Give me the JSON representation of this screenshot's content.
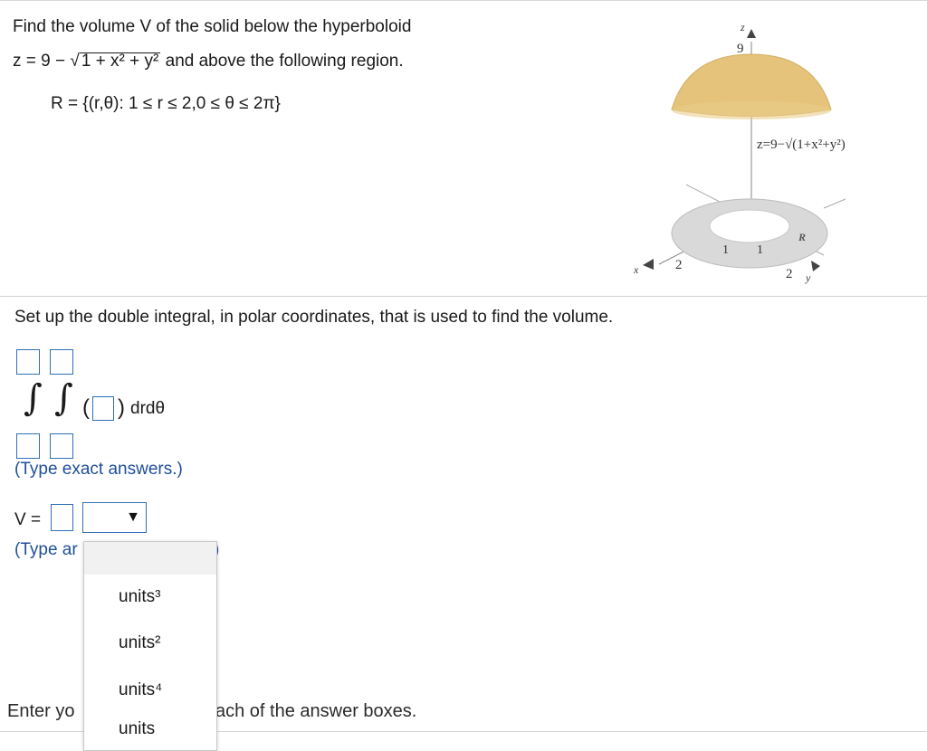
{
  "problem": {
    "line1": "Find the volume V of the solid below the hyperboloid",
    "z_prefix": "z = 9 − ",
    "sqrt_content": "1 + x² + y²",
    "line2_suffix": "and above the following region.",
    "region": "R = {(r,θ): 1 ≤ r ≤ 2,0 ≤ θ ≤ 2π}"
  },
  "figure": {
    "z_axis_label": "z",
    "z_value": "9",
    "surface_label": "z=9−√(1+x²+y²)",
    "region_label": "R",
    "x_axis_label": "x",
    "y_axis_label": "y",
    "tick_x": "2",
    "tick_y": "2",
    "tick_1a": "1",
    "tick_1b": "1"
  },
  "setup": {
    "instruction": "Set up the double integral, in polar coordinates, that is used to find the volume.",
    "integral_suffix": "drdθ",
    "note": "(Type exact answers.)"
  },
  "volume": {
    "label": "V =",
    "note_visible": "(Type ar",
    "note_tail": ")"
  },
  "units_dropdown": {
    "options": [
      "units³",
      "units²",
      "units⁴",
      "units"
    ]
  },
  "footer": {
    "left": "Enter yo",
    "right": "ach of the answer boxes."
  },
  "colors": {
    "accent": "#2f6fb7",
    "dome": "#e5c37a",
    "annulus": "#d9d9d9"
  }
}
